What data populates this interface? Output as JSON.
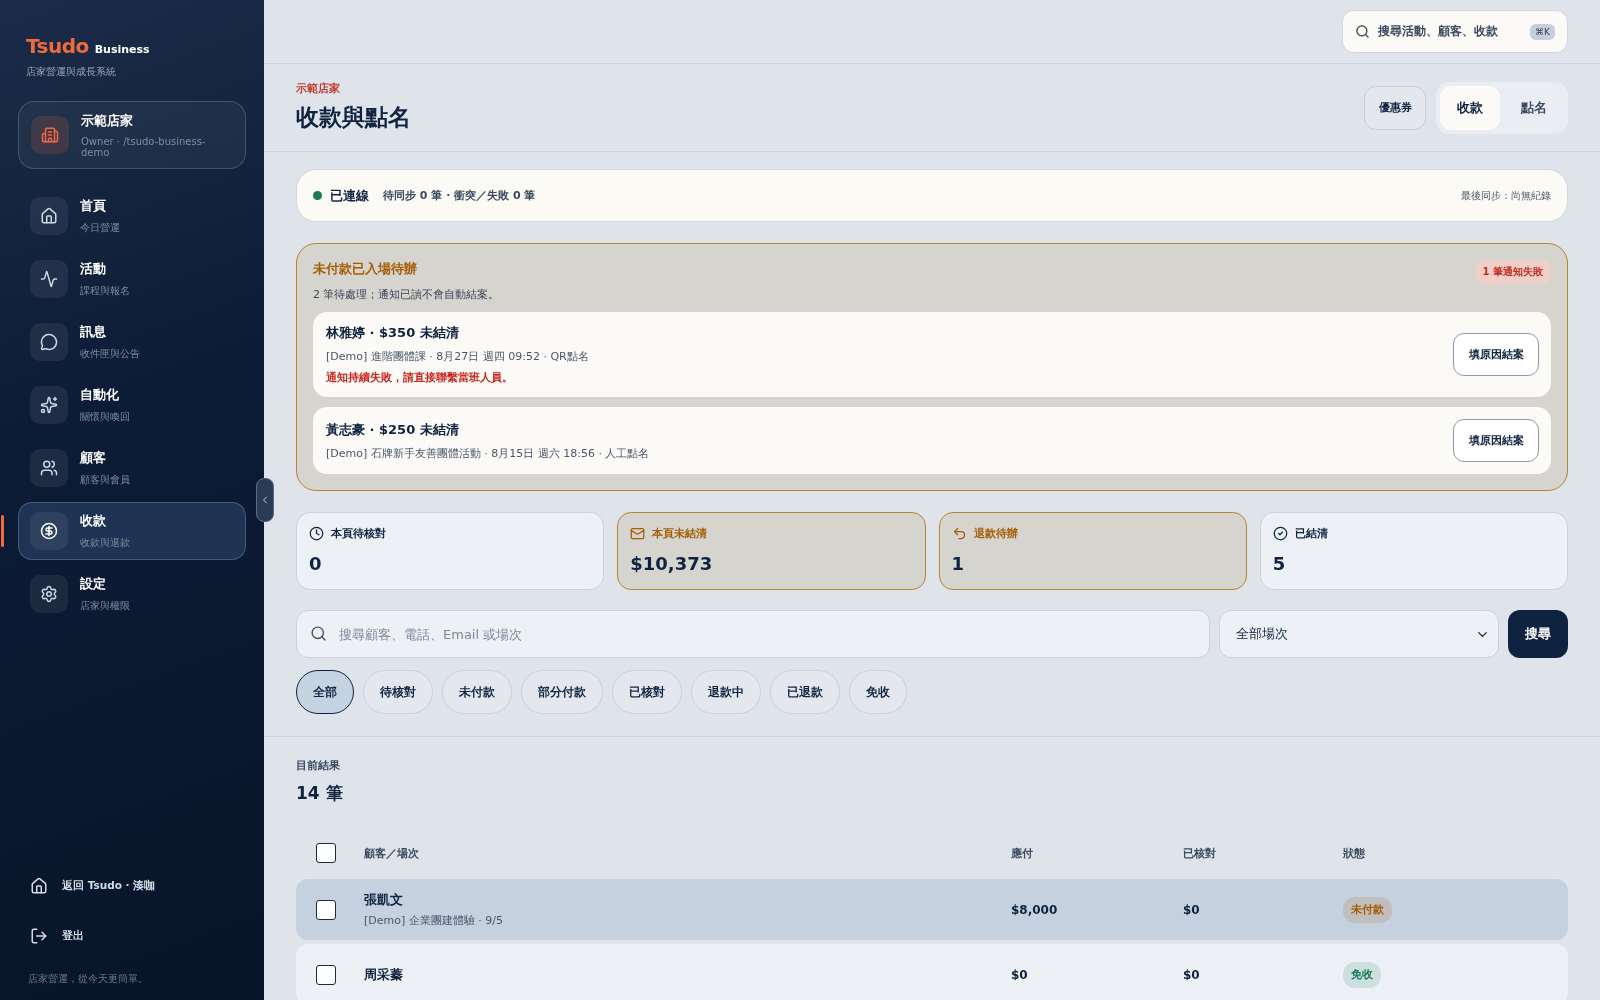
{
  "sidebar": {
    "logo": "Tsudo",
    "logo_suffix": "Business",
    "tagline": "店家營運與成長系統",
    "store": {
      "name": "示範店家",
      "meta": "Owner · /tsudo-business-demo"
    },
    "items": [
      {
        "label": "首頁",
        "sub": "今日營運",
        "selected": false
      },
      {
        "label": "活動",
        "sub": "課程與報名",
        "selected": false
      },
      {
        "label": "訊息",
        "sub": "收件匣與公告",
        "selected": false
      },
      {
        "label": "自動化",
        "sub": "關懷與喚回",
        "selected": false
      },
      {
        "label": "顧客",
        "sub": "顧客與會員",
        "selected": false
      },
      {
        "label": "收款",
        "sub": "收款與退款",
        "selected": true
      },
      {
        "label": "設定",
        "sub": "店家與權限",
        "selected": false
      }
    ],
    "footer_links": [
      "返回 Tsudo · 湊咖",
      "登出"
    ],
    "footer_note": "店家營運，從今天更簡單。"
  },
  "topbar": {
    "search_placeholder": "搜尋活動、顧客、收款",
    "shortcut": "⌘K"
  },
  "header": {
    "eyebrow": "示範店家",
    "title": "收款與點名",
    "coupon_button": "優惠券",
    "tabs": [
      {
        "label": "收款",
        "selected": true
      },
      {
        "label": "點名",
        "selected": false
      }
    ]
  },
  "sync": {
    "connected": true,
    "status": "已連線",
    "detail": "待同步 **0** 筆 · 衝突／失敗 **0** 筆",
    "last_sync": "最後同步：尚無紀錄"
  },
  "alert": {
    "title": "未付款已入場待辦",
    "summary": "2 筆待處理；通知已讀不會自動結案。",
    "badge": "1 筆通知失敗",
    "items": [
      {
        "title": "林雅婷 · $350 未結清",
        "detail": "[Demo] 進階團體課 · 8月27日 週四 09:52 · QR點名",
        "error": "通知持續失敗，請直接聯繫當班人員。",
        "button": "填原因結案"
      },
      {
        "title": "黃志豪 · $250 未結清",
        "detail": "[Demo] 石牌新手友善團體活動 · 8月15日 週六 18:56 · 人工點名",
        "button": "填原因結案"
      }
    ]
  },
  "stats": [
    {
      "label": "本頁待核對",
      "value": "0",
      "highlighted": false
    },
    {
      "label": "本頁未結清",
      "value": "$10,373",
      "highlighted": true
    },
    {
      "label": "退款待辦",
      "value": "1",
      "highlighted": true
    },
    {
      "label": "已結清",
      "value": "5",
      "highlighted": false
    }
  ],
  "filters": {
    "search_placeholder": "搜尋顧客、電話、Email 或場次",
    "session_select": "全部場次",
    "search_button": "搜尋",
    "chips": [
      {
        "label": "全部",
        "selected": true
      },
      {
        "label": "待核對",
        "selected": false
      },
      {
        "label": "未付款",
        "selected": false
      },
      {
        "label": "部分付款",
        "selected": false
      },
      {
        "label": "已核對",
        "selected": false
      },
      {
        "label": "退款中",
        "selected": false
      },
      {
        "label": "已退款",
        "selected": false
      },
      {
        "label": "免收",
        "selected": false
      }
    ]
  },
  "results": {
    "label": "目前結果",
    "count": "14 筆"
  },
  "table": {
    "select_all_checked": false,
    "columns": [
      "顧客／場次",
      "應付",
      "已核對",
      "狀態"
    ],
    "rows": [
      {
        "name": "張凱文",
        "session": "[Demo] 企業團建體驗 · 9/5",
        "due": "$8,000",
        "verified": "$0",
        "status": "未付款",
        "color": "#a55d05",
        "checked": false,
        "selected": true
      },
      {
        "name": "周采蓁",
        "due": "$0",
        "verified": "$0",
        "status": "免收",
        "color": "#1a7a54",
        "checked": false,
        "selected": false
      }
    ]
  }
}
